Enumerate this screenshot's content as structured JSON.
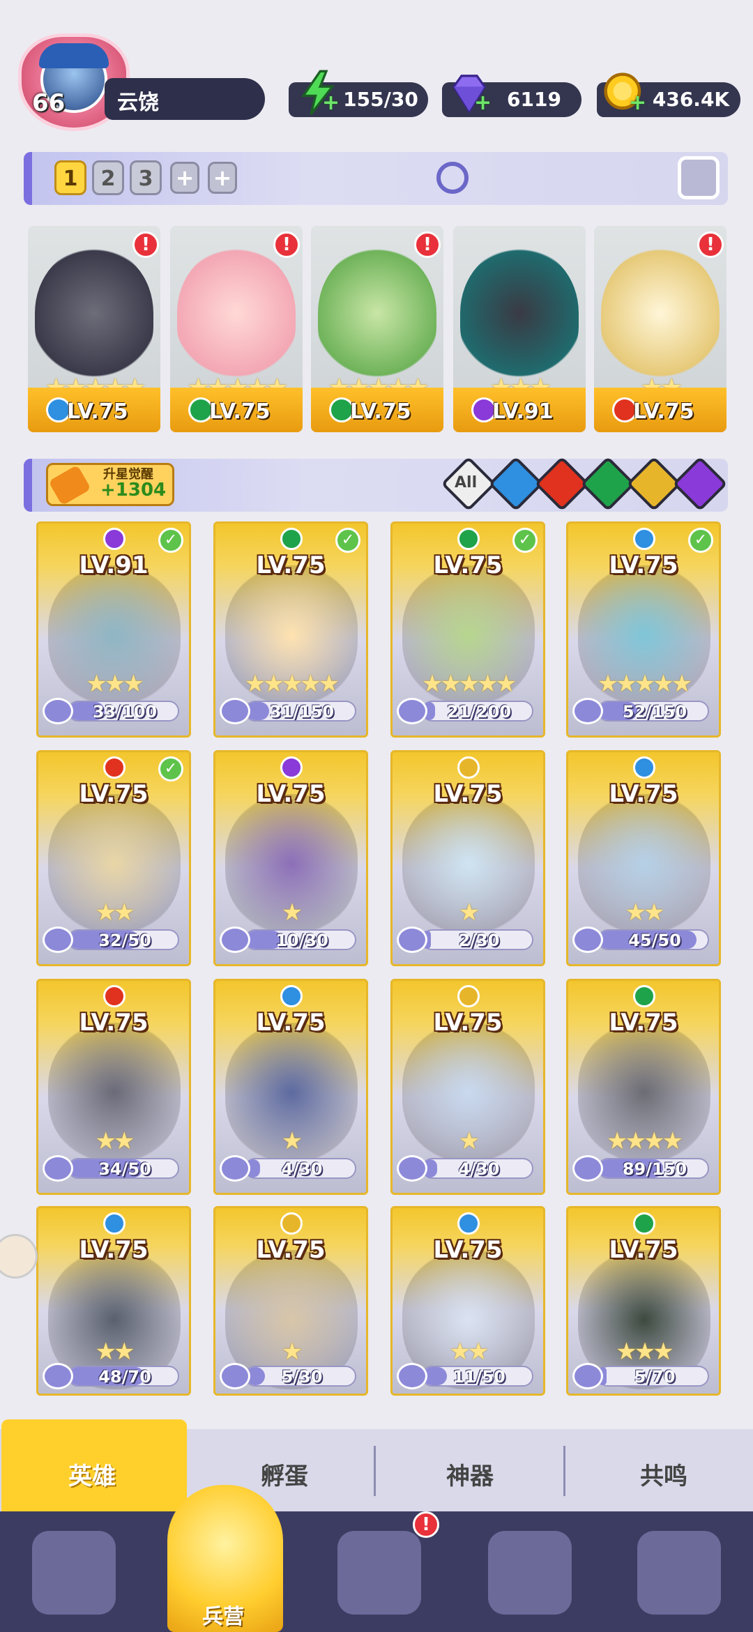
{
  "player": {
    "level": "66",
    "name": "云饶"
  },
  "resources": {
    "energy": "155/30",
    "gems": "6119",
    "coins": "436.4K"
  },
  "team_tabs": [
    "1",
    "2",
    "3"
  ],
  "team_add": "+",
  "team": [
    {
      "level": "LV.75",
      "stars": "★★★★★",
      "element": "water",
      "alert": "!"
    },
    {
      "level": "LV.75",
      "stars": "★★★★★",
      "element": "nature",
      "alert": "!"
    },
    {
      "level": "LV.75",
      "stars": "★★★★★",
      "element": "nature",
      "alert": "!"
    },
    {
      "level": "LV.91",
      "stars": "★★★",
      "element": "dark",
      "alert": ""
    },
    {
      "level": "LV.75",
      "stars": "★★",
      "element": "fire",
      "alert": "!"
    }
  ],
  "awaken": {
    "label": "升星觉醒",
    "value": "+1304"
  },
  "filter_all": "All",
  "heroes": [
    {
      "level": "LV.91",
      "element": "dark",
      "stars": "★★★",
      "shards": "33/100",
      "progress": 0.33,
      "check": true
    },
    {
      "level": "LV.75",
      "element": "nature",
      "stars": "★★★★★",
      "shards": "31/150",
      "progress": 0.21,
      "check": true
    },
    {
      "level": "LV.75",
      "element": "nature",
      "stars": "★★★★★",
      "shards": "21/200",
      "progress": 0.11,
      "check": true
    },
    {
      "level": "LV.75",
      "element": "water",
      "stars": "★★★★★",
      "shards": "52/150",
      "progress": 0.35,
      "check": true
    },
    {
      "level": "LV.75",
      "element": "fire",
      "stars": "★★",
      "shards": "32/50",
      "progress": 0.64,
      "check": true
    },
    {
      "level": "LV.75",
      "element": "dark",
      "stars": "★",
      "shards": "10/30",
      "progress": 0.33,
      "check": false
    },
    {
      "level": "LV.75",
      "element": "light",
      "stars": "★",
      "shards": "2/30",
      "progress": 0.07,
      "check": false
    },
    {
      "level": "LV.75",
      "element": "water",
      "stars": "★★",
      "shards": "45/50",
      "progress": 0.9,
      "check": false
    },
    {
      "level": "LV.75",
      "element": "fire",
      "stars": "★★",
      "shards": "34/50",
      "progress": 0.68,
      "check": false
    },
    {
      "level": "LV.75",
      "element": "water",
      "stars": "★",
      "shards": "4/30",
      "progress": 0.13,
      "check": false
    },
    {
      "level": "LV.75",
      "element": "light",
      "stars": "★",
      "shards": "4/30",
      "progress": 0.13,
      "check": false
    },
    {
      "level": "LV.75",
      "element": "nature",
      "stars": "★★★★",
      "shards": "89/150",
      "progress": 0.59,
      "check": false
    },
    {
      "level": "LV.75",
      "element": "water",
      "stars": "★★",
      "shards": "48/70",
      "progress": 0.69,
      "check": false
    },
    {
      "level": "LV.75",
      "element": "light",
      "stars": "★",
      "shards": "5/30",
      "progress": 0.17,
      "check": false
    },
    {
      "level": "LV.75",
      "element": "water",
      "stars": "★★",
      "shards": "11/50",
      "progress": 0.22,
      "check": false
    },
    {
      "level": "LV.75",
      "element": "nature",
      "stars": "★★★",
      "shards": "5/70",
      "progress": 0.07,
      "check": false
    }
  ],
  "subtabs": {
    "heroes": "英雄",
    "hatch": "孵蛋",
    "artifacts": "神器",
    "resonance": "共鸣"
  },
  "nav": {
    "barracks": "兵营",
    "alert": "!"
  },
  "colors": {
    "water": "#2f8fe0",
    "nature": "#1fa34a",
    "dark": "#8a3ad8",
    "fire": "#e0321e",
    "light": "#e7b52a",
    "accent": "#ffd02c"
  }
}
